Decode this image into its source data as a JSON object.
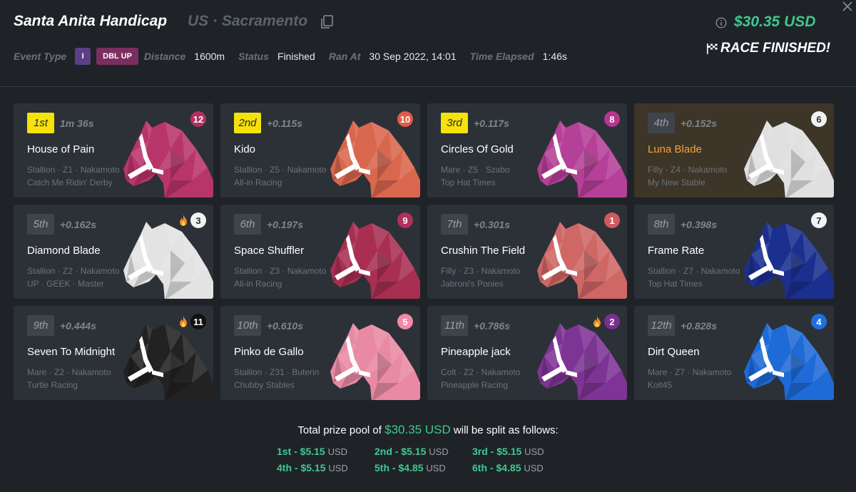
{
  "race": {
    "title": "Santa Anita Handicap",
    "location": "US · Sacramento",
    "total_pool": "$30.35 USD",
    "finished_label": "RACE FINISHED!"
  },
  "meta": {
    "event_type_label": "Event Type",
    "class_badge": "I",
    "event_badge": "DBL UP",
    "distance_label": "Distance",
    "distance": "1600m",
    "status_label": "Status",
    "status": "Finished",
    "ran_at_label": "Ran At",
    "ran_at": "30 Sep 2022, 14:01",
    "elapsed_label": "Time Elapsed",
    "elapsed": "1:46s"
  },
  "results": [
    {
      "pos": "1st",
      "time": "1m 36s",
      "name": "House of Pain",
      "detail": "Stallion · Z1 · Nakamoto",
      "stable": "Catch Me Ridin' Derby",
      "gate": "12",
      "gate_bg": "#b0305e",
      "gate_fg": "#ffffff",
      "horse_color": "#b8356a",
      "flame": false,
      "gold": true,
      "highlight": false
    },
    {
      "pos": "2nd",
      "time": "+0.115s",
      "name": "Kido",
      "detail": "Stallion · Z5 · Nakamoto",
      "stable": "All-in Racing",
      "gate": "10",
      "gate_bg": "#e35a45",
      "gate_fg": "#ffffff",
      "horse_color": "#d9674d",
      "flame": false,
      "gold": true,
      "highlight": false
    },
    {
      "pos": "3rd",
      "time": "+0.117s",
      "name": "Circles Of Gold",
      "detail": "Mare · Z5 · Szabo",
      "stable": "Top Hat Times",
      "gate": "8",
      "gate_bg": "#b7368e",
      "gate_fg": "#ffffff",
      "horse_color": "#b54097",
      "flame": false,
      "gold": true,
      "highlight": false
    },
    {
      "pos": "4th",
      "time": "+0.152s",
      "name": "Luna Blade",
      "detail": "Filly · Z4 · Nakamoto",
      "stable": "My New Stable",
      "gate": "6",
      "gate_bg": "#f2f2f2",
      "gate_fg": "#2c3138",
      "horse_color": "#e0e0e0",
      "flame": false,
      "gold": false,
      "highlight": true
    },
    {
      "pos": "5th",
      "time": "+0.162s",
      "name": "Diamond Blade",
      "detail": "Stallion · Z2 · Nakamoto",
      "stable": "UP · GEEK · Master",
      "gate": "3",
      "gate_bg": "#f2f2f2",
      "gate_fg": "#2c3138",
      "horse_color": "#e3e3e3",
      "flame": true,
      "gold": false,
      "highlight": false
    },
    {
      "pos": "6th",
      "time": "+0.197s",
      "name": "Space Shuffler",
      "detail": "Stallion · Z3 · Nakamoto",
      "stable": "All-in Racing",
      "gate": "9",
      "gate_bg": "#b0305e",
      "gate_fg": "#ffffff",
      "horse_color": "#a82f52",
      "flame": false,
      "gold": false,
      "highlight": false
    },
    {
      "pos": "7th",
      "time": "+0.301s",
      "name": "Crushin The Field",
      "detail": "Filly · Z3 · Nakamoto",
      "stable": "Jabroni's Ponies",
      "gate": "1",
      "gate_bg": "#d2595d",
      "gate_fg": "#ffffff",
      "horse_color": "#cf6765",
      "flame": false,
      "gold": false,
      "highlight": false
    },
    {
      "pos": "8th",
      "time": "+0.398s",
      "name": "Frame Rate",
      "detail": "Stallion · Z7 · Nakamoto",
      "stable": "Top Hat Times",
      "gate": "7",
      "gate_bg": "#f2f2f2",
      "gate_fg": "#2c3138",
      "horse_color": "#1b2f8f",
      "flame": false,
      "gold": false,
      "highlight": false
    },
    {
      "pos": "9th",
      "time": "+0.444s",
      "name": "Seven To Midnight",
      "detail": "Mare · Z2 · Nakamoto",
      "stable": "Turtle Racing",
      "gate": "11",
      "gate_bg": "#111111",
      "gate_fg": "#ffffff",
      "horse_color": "#222222",
      "flame": true,
      "gold": false,
      "highlight": false
    },
    {
      "pos": "10th",
      "time": "+0.610s",
      "name": "Pinko de Gallo",
      "detail": "Stallion · Z31 · Buterin",
      "stable": "Chubby Stables",
      "gate": "5",
      "gate_bg": "#f08aa6",
      "gate_fg": "#ffffff",
      "horse_color": "#e98aa4",
      "flame": false,
      "gold": false,
      "highlight": false
    },
    {
      "pos": "11th",
      "time": "+0.786s",
      "name": "Pineapple jack",
      "detail": "Colt · Z2 · Nakamoto",
      "stable": "Pineapple Racing",
      "gate": "2",
      "gate_bg": "#7a2f8f",
      "gate_fg": "#ffffff",
      "horse_color": "#7e3494",
      "flame": true,
      "gold": false,
      "highlight": false
    },
    {
      "pos": "12th",
      "time": "+0.828s",
      "name": "Dirt Queen",
      "detail": "Mare · Z7 · Nakamoto",
      "stable": "Kolt45",
      "gate": "4",
      "gate_bg": "#1f6fe0",
      "gate_fg": "#ffffff",
      "horse_color": "#1e6ad6",
      "flame": false,
      "gold": false,
      "highlight": false
    }
  ],
  "prize": {
    "intro": "Total prize pool of",
    "amount": "$30.35 USD",
    "outro": "will be split as follows:",
    "payouts": [
      {
        "place": "1st - $5.15",
        "unit": "USD"
      },
      {
        "place": "2nd - $5.15",
        "unit": "USD"
      },
      {
        "place": "3rd - $5.15",
        "unit": "USD"
      },
      {
        "place": "4th - $5.15",
        "unit": "USD"
      },
      {
        "place": "5th - $4.85",
        "unit": "USD"
      },
      {
        "place": "6th - $4.85",
        "unit": "USD"
      }
    ]
  },
  "colors": {
    "accent_green": "#3ec98f",
    "gold": "#f5e20a",
    "highlight_orange": "#f0a43a"
  },
  "icons": {
    "copy": "copy-icon",
    "close": "close-icon",
    "info": "info-icon",
    "flag": "checkered-flag-icon",
    "flame": "flame-icon"
  }
}
